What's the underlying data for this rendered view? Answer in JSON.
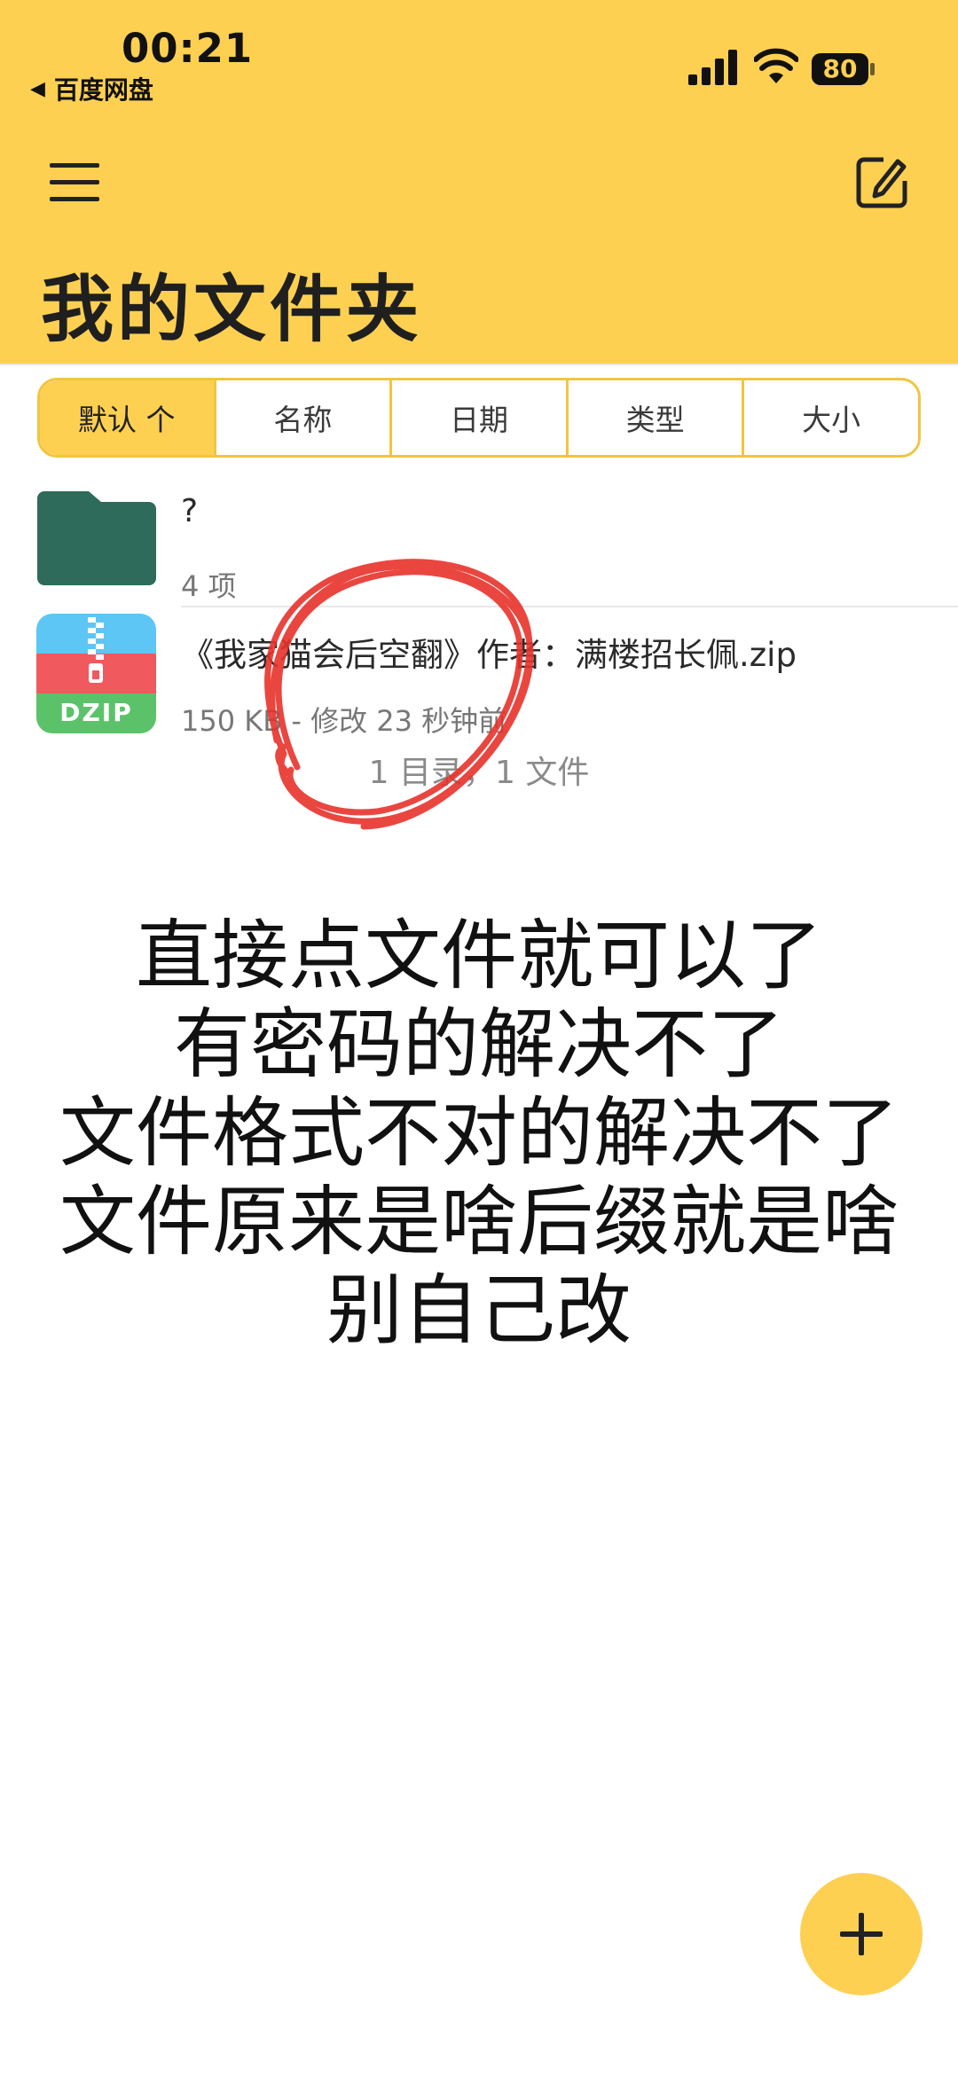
{
  "status_bar": {
    "time": "00:21",
    "back_app": "百度网盘",
    "battery": "80"
  },
  "header": {
    "title": "我的文件夹",
    "menu_icon": "hamburger-menu-icon",
    "edit_icon": "edit-note-icon"
  },
  "sort_tabs": [
    "默认 个",
    "名称",
    "日期",
    "类型",
    "大小"
  ],
  "files": [
    {
      "name": "?",
      "meta": "4 项",
      "icon": "folder-icon"
    },
    {
      "name": "《我家猫会后空翻》作者：满楼招长佩.zip",
      "meta": "150 KB - 修改 23 秒钟前",
      "icon": "dzip-icon",
      "icon_label": "DZIP"
    }
  ],
  "summary": "1 目录，1 文件",
  "caption_lines": [
    "直接点文件就可以了",
    "有密码的解决不了",
    "文件格式不对的解决不了",
    "文件原来是啥后缀就是啥",
    "别自己改"
  ],
  "fab_icon": "plus-icon",
  "colors": {
    "accent": "#fdd052",
    "folder": "#2e6b5a",
    "annotation": "#e8322c"
  }
}
